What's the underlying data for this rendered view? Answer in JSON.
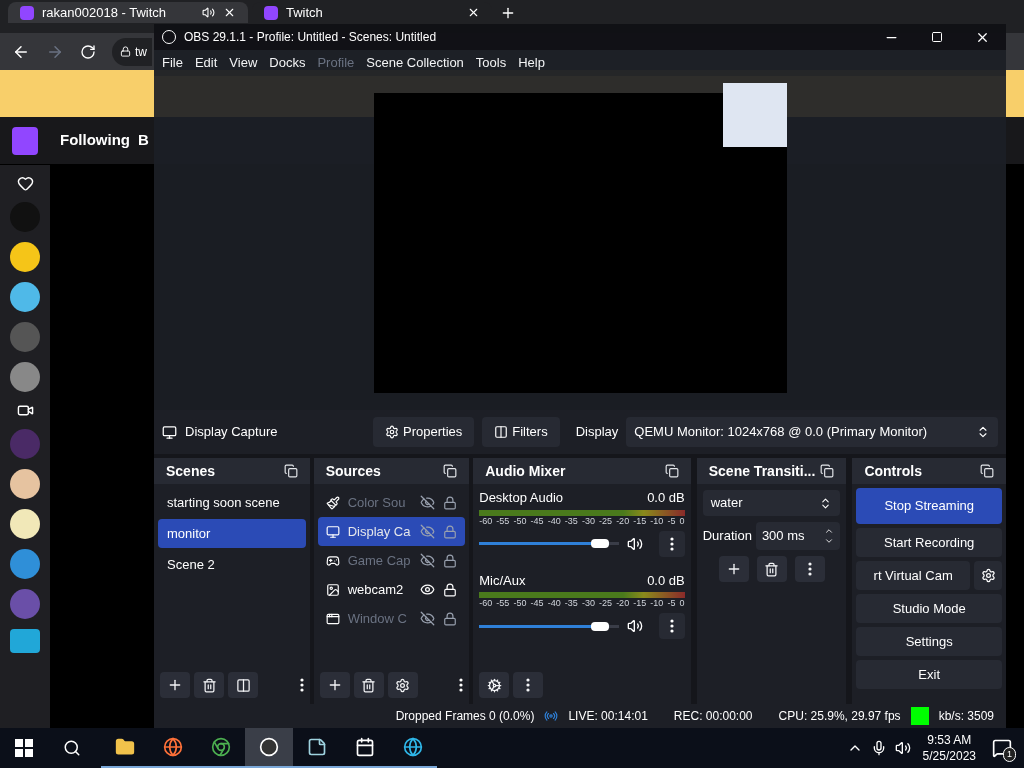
{
  "browser": {
    "tabs": [
      {
        "title": "rakan002018 - Twitch",
        "selected": true,
        "audio": true
      },
      {
        "title": "Twitch",
        "selected": false,
        "audio": false
      }
    ],
    "url": "tw",
    "nav": [
      "Following",
      "B"
    ]
  },
  "obs": {
    "title": "OBS 29.1.1 - Profile: Untitled - Scenes: Untitled",
    "menu": [
      {
        "label": "File",
        "disabled": false
      },
      {
        "label": "Edit",
        "disabled": false
      },
      {
        "label": "View",
        "disabled": false
      },
      {
        "label": "Docks",
        "disabled": false
      },
      {
        "label": "Profile",
        "disabled": true
      },
      {
        "label": "Scene Collection",
        "disabled": false
      },
      {
        "label": "Tools",
        "disabled": false
      },
      {
        "label": "Help",
        "disabled": false
      }
    ],
    "source_toolbar": {
      "source": "Display Capture",
      "buttons": [
        {
          "kind": "properties",
          "label": "Properties"
        },
        {
          "kind": "filters",
          "label": "Filters"
        }
      ],
      "display_label": "Display",
      "display_value": "QEMU Monitor: 1024x768 @ 0.0 (Primary Monitor)"
    },
    "scenes": {
      "title": "Scenes",
      "items": [
        {
          "label": "starting soon scene",
          "selected": false
        },
        {
          "label": "monitor",
          "selected": true
        },
        {
          "label": "Scene 2",
          "selected": false
        }
      ]
    },
    "sources": {
      "title": "Sources",
      "items": [
        {
          "kind": "color",
          "label": "Color Sou",
          "visible": false,
          "locked": true,
          "selected": false
        },
        {
          "kind": "display",
          "label": "Display Ca",
          "visible": false,
          "locked": true,
          "selected": true
        },
        {
          "kind": "game",
          "label": "Game Cap",
          "visible": false,
          "locked": true,
          "selected": false
        },
        {
          "kind": "image",
          "label": "webcam2",
          "visible": true,
          "locked": true,
          "selected": false
        },
        {
          "kind": "window",
          "label": "Window C",
          "visible": false,
          "locked": true,
          "selected": false
        }
      ]
    },
    "audio_mixer": {
      "title": "Audio Mixer",
      "channels": [
        {
          "name": "Desktop Audio",
          "reading": "0.0 dB",
          "level": 0.93,
          "scale": [
            "-60",
            "-55",
            "-50",
            "-45",
            "-40",
            "-35",
            "-30",
            "-25",
            "-20",
            "-15",
            "-10",
            "-5",
            "0"
          ]
        },
        {
          "name": "Mic/Aux",
          "reading": "0.0 dB",
          "level": 0.93,
          "scale": [
            "-60",
            "-55",
            "-50",
            "-45",
            "-40",
            "-35",
            "-30",
            "-25",
            "-20",
            "-15",
            "-10",
            "-5",
            "0"
          ]
        }
      ]
    },
    "transitions": {
      "title": "Scene Transiti...",
      "transition": "water",
      "duration_label": "Duration",
      "duration": "300 ms"
    },
    "controls": {
      "title": "Controls",
      "buttons": [
        {
          "label": "Stop Streaming",
          "active": true,
          "gear": false
        },
        {
          "label": "Start Recording",
          "active": false,
          "gear": false
        },
        {
          "label": "rt Virtual Cam",
          "active": false,
          "gear": true
        },
        {
          "label": "Studio Mode",
          "active": false,
          "gear": false
        },
        {
          "label": "Settings",
          "active": false,
          "gear": false
        },
        {
          "label": "Exit",
          "active": false,
          "gear": false
        }
      ]
    },
    "status": {
      "dropped": "Dropped Frames 0 (0.0%)",
      "live": "LIVE: 00:14:01",
      "rec": "REC: 00:00:00",
      "cpu": "CPU: 25.9%, 29.97 fps",
      "kbps": "kb/s: 3509"
    }
  },
  "taskbar": {
    "apps": [
      {
        "kind": "explorer",
        "selected": false
      },
      {
        "kind": "firefox",
        "selected": false
      },
      {
        "kind": "chrome",
        "selected": false
      },
      {
        "kind": "obs",
        "selected": true
      },
      {
        "kind": "notes",
        "selected": false
      },
      {
        "kind": "calendar",
        "selected": false
      },
      {
        "kind": "edge",
        "selected": false
      }
    ],
    "time": "9:53 AM",
    "date": "5/25/2023",
    "notifications": "1"
  }
}
